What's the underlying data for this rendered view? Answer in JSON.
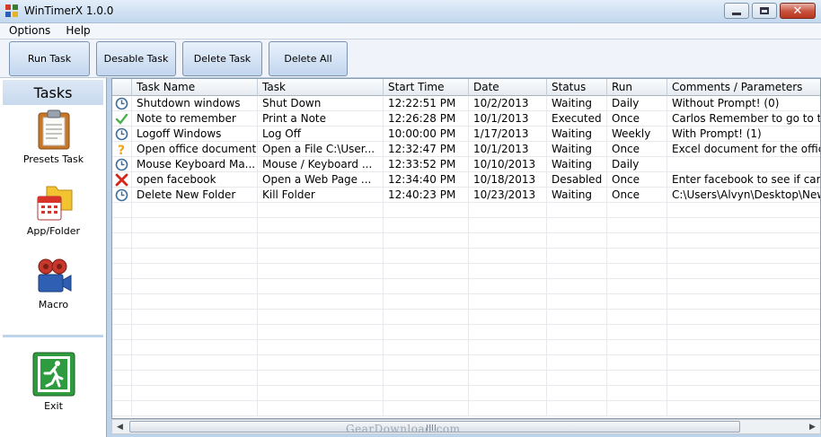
{
  "window": {
    "title": "WinTimerX 1.0.0"
  },
  "menu": [
    "Options",
    "Help"
  ],
  "toolbar": {
    "run_label": "Run Task",
    "disable_label": "Desable Task",
    "delete_label": "Delete Task",
    "delete_all_label": "Delete All"
  },
  "sidebar": {
    "title": "Tasks",
    "items": [
      {
        "label": "Presets Task",
        "icon": "clipboard-icon"
      },
      {
        "label": "App/Folder",
        "icon": "folder-calendar-icon"
      },
      {
        "label": "Macro",
        "icon": "video-camera-icon"
      }
    ],
    "exit_label": "Exit"
  },
  "table": {
    "columns": [
      "Task Name",
      "Task",
      "Start Time",
      "Date",
      "Status",
      "Run",
      "Comments / Parameters"
    ],
    "rows": [
      {
        "icon": "clock-icon",
        "cells": [
          "Shutdown windows",
          "Shut Down",
          "12:22:51 PM",
          "10/2/2013",
          "Waiting",
          "Daily",
          "Without Prompt! (0)"
        ]
      },
      {
        "icon": "checkmark-icon",
        "cells": [
          "Note to remember",
          "Print a Note",
          "12:26:28 PM",
          "10/1/2013",
          "Executed",
          "Once",
          "Carlos Remember to go to th"
        ]
      },
      {
        "icon": "clock-icon",
        "cells": [
          "Logoff Windows",
          "Log Off",
          "10:00:00 PM",
          "1/17/2013",
          "Waiting",
          "Weekly",
          "With Prompt! (1)"
        ]
      },
      {
        "icon": "question-icon",
        "cells": [
          "Open office document",
          "Open a File C:\\User...",
          "12:32:47 PM",
          "10/1/2013",
          "Waiting",
          "Once",
          "Excel document for the office"
        ]
      },
      {
        "icon": "clock-icon",
        "cells": [
          "Mouse Keyboard Ma...",
          "Mouse / Keyboard ...",
          "12:33:52 PM",
          "10/10/2013",
          "Waiting",
          "Daily",
          ""
        ]
      },
      {
        "icon": "x-icon",
        "cells": [
          "open facebook",
          "Open a Web Page ...",
          "12:34:40 PM",
          "10/18/2013",
          "Desabled",
          "Once",
          "Enter facebook to see if caro"
        ]
      },
      {
        "icon": "clock-icon",
        "cells": [
          "Delete New Folder",
          "Kill Folder",
          "12:40:23 PM",
          "10/23/2013",
          "Waiting",
          "Once",
          "C:\\Users\\Alvyn\\Desktop\\New"
        ]
      }
    ]
  },
  "watermark": "GearDownload.com",
  "colors": {
    "titlebar": "#cfe0f2",
    "toolbar_button": "#c2d6ee",
    "close_button": "#c7503c"
  }
}
